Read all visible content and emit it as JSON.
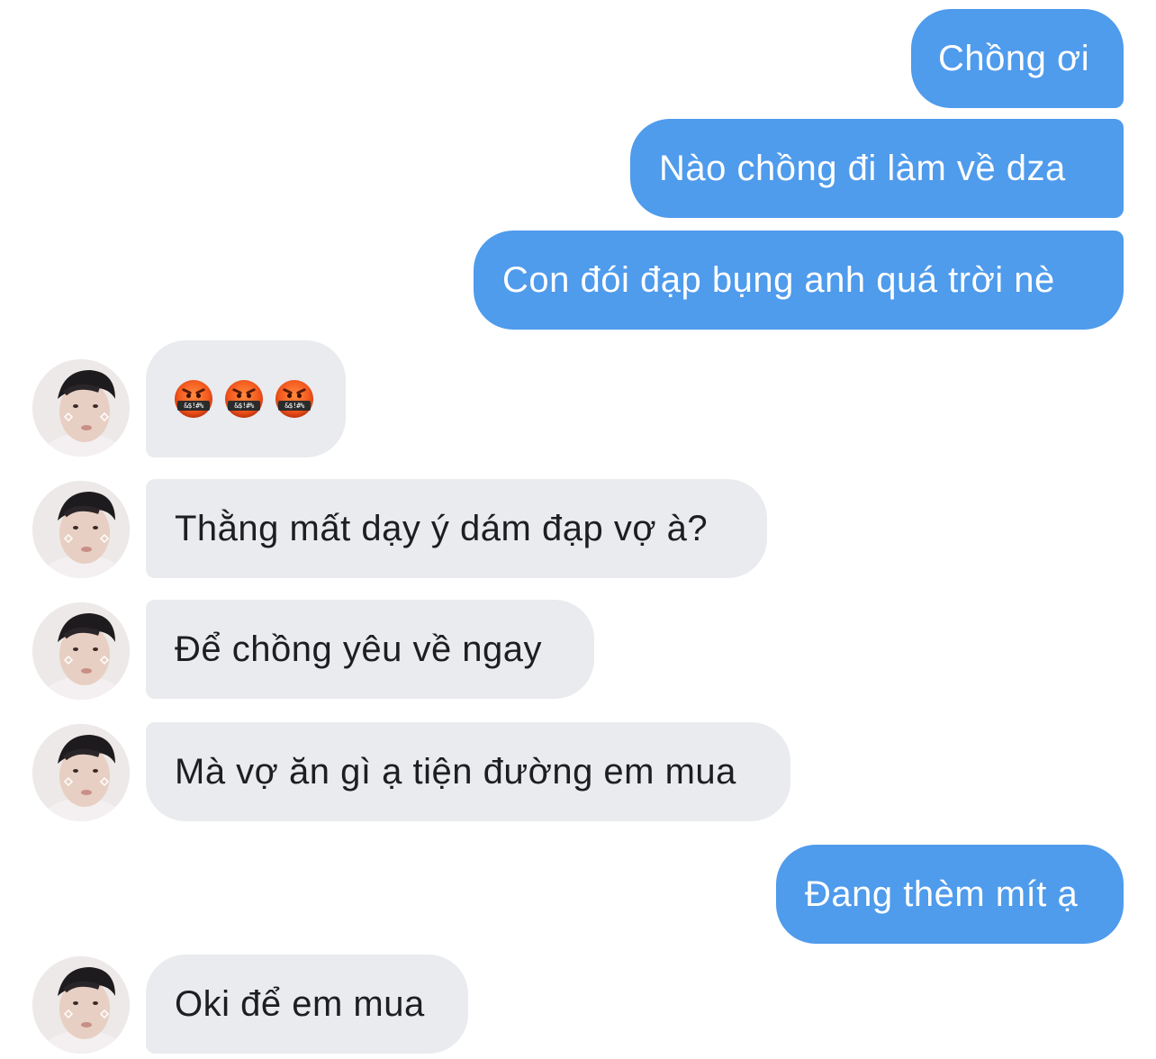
{
  "messages": {
    "sent_1": "Chồng ơi",
    "sent_2": "Nào chồng đi làm về dza",
    "sent_3": "Con đói đạp bụng anh quá trời nè",
    "recv_1_emoji": [
      "&$!#%",
      "&$!#%",
      "&$!#%"
    ],
    "recv_2": "Thằng mất dạy ý dám đạp vợ à?",
    "recv_3": "Để chồng yêu về ngay",
    "recv_4": "Mà vợ ăn gì ạ tiện đường em mua",
    "sent_4": "Đang thèm mít ạ",
    "recv_5": "Oki để em mua"
  },
  "colors": {
    "sent_bubble": "#4f9bec",
    "received_bubble": "#e9ebee",
    "sent_text": "#ffffff",
    "received_text": "#1c1e21"
  },
  "icons": {
    "reaction_emoji": "face-with-symbols-on-mouth",
    "contact_avatar": "contact-avatar-photo"
  }
}
